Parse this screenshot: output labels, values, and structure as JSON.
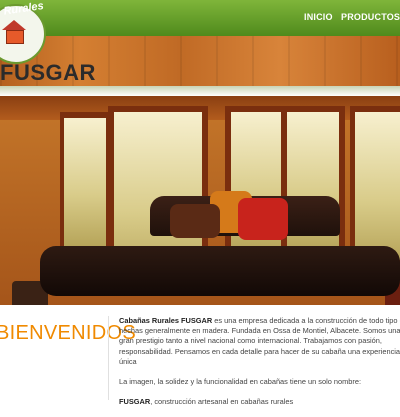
{
  "header": {
    "logo": {
      "arc_text": "Rurales",
      "word": "FUSGAR"
    },
    "nav": [
      {
        "label": "INICIO"
      },
      {
        "label": "PRODUCTOS"
      }
    ]
  },
  "hero": {
    "icon": "living-room-photo"
  },
  "welcome": {
    "heading": "BIENVENIDOS",
    "paragraph1_bold": "Cabañas Rurales FUSGAR",
    "paragraph1_text": " es una empresa dedicada a la construcción de todo tipo de hechas generalmente en madera. Fundada en Ossa de Montiel, Albacete. Somos una e gran prestigio tanto a nivel nacional como internacional. Trabajamos con pasión, responsabilidad. Pensamos en cada detalle para hacer de su cabaña una experiencia única",
    "paragraph2": "La imagen, la solidez y la funcionalidad en cabañas tiene un solo nombre:",
    "paragraph3_bold": "FUSGAR",
    "paragraph3_text": ", construcción artesanal en cabañas rurales"
  },
  "colors": {
    "nav_green": "#5f9a24",
    "accent_orange": "#f08a00",
    "wood": "#c76e28"
  }
}
